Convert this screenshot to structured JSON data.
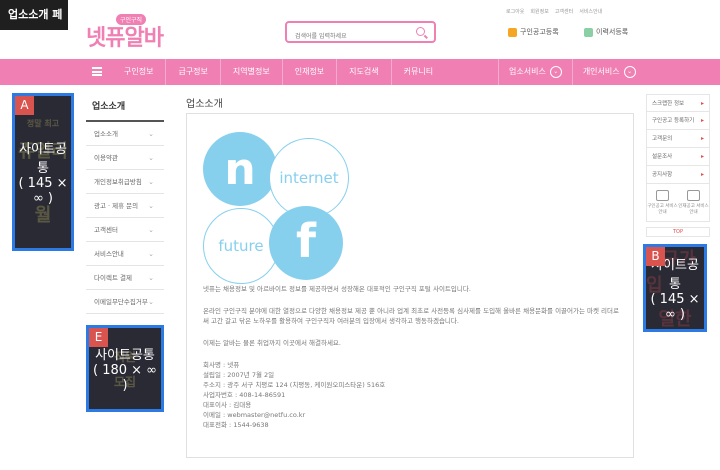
{
  "page_label": "업소소개 페이지",
  "header": {
    "logo_text": "넷퓨알바",
    "logo_badge": "구인구직",
    "search_placeholder": "검색어를 입력하세요",
    "top_links": [
      "로그아웃",
      "회원정보",
      "고객센터",
      "서비스안내"
    ],
    "post_job_label": "구인공고등록",
    "resume_label": "이력서등록"
  },
  "nav": {
    "items": [
      "구인정보",
      "급구정보",
      "지역별정보",
      "인재정보",
      "지도검색",
      "커뮤니티"
    ],
    "business_service": "업소서비스",
    "personal_service": "개인서비스"
  },
  "ads": {
    "a": {
      "letter": "A",
      "line1": "사이트공통",
      "line2": "( 145 × ∞ )",
      "bg_words": [
        "정말 최고",
        "쥬얼리",
        "월"
      ]
    },
    "b": {
      "letter": "B",
      "line1": "사이트공통",
      "line2": "( 145 × ∞ )",
      "bg_words": [
        "신규가입",
        "열한"
      ]
    },
    "e": {
      "letter": "E",
      "line1": "사이트공통",
      "line2": "( 180 × ∞ )",
      "bg_words": [
        "직원",
        "모집"
      ]
    }
  },
  "sidebar": {
    "title": "업소소개",
    "items": [
      "업소소개",
      "이용약관",
      "개인정보취급방침",
      "광고 · 제휴 문의",
      "고객센터",
      "서비스안내",
      "다이렉트 결제",
      "이메일무단수집거부"
    ]
  },
  "content": {
    "title": "업소소개",
    "logo_words": {
      "n": "n",
      "internet": "internet",
      "future": "future",
      "f": "f"
    },
    "paragraph1": "넷퓨는 채용정보 및 아르바이트 정보를 제공하면서 성장해온 대표적인 구인구직 포털 사이트입니다.",
    "paragraph2": "온라인 구인구직 분야에 대한 열정으로 다양한 채용정보 제공 뿐 아니라 업계 최초로 사전등록 심사제를 도입해 올바른 채용문화를 이끌어가는 마켓 리더로써 고간 갈고 닦은 노하우를 활용하여 구인구직자 여러분의 입장에서 생각하고 행동하겠습니다.",
    "paragraph3": "이제는 알바는 물론 취업까지 이곳에서 해결하세요.",
    "company": [
      "회사명 : 넷퓨",
      "설립일 : 2007년 7월 2일",
      "주소지 : 광주 서구 치평로 124 (치평동, 케이원오피스타운) 516호",
      "사업자번호 : 408-14-86591",
      "대표이사 : 김대용",
      "이메일 : webmaster@netfu.co.kr",
      "대표전화 : 1544-9638"
    ]
  },
  "right_sidebar": {
    "items": [
      "스크랩한 정보",
      "구인공고 등록하기",
      "고객문의",
      "설문조사",
      "공지사항"
    ],
    "icons": [
      "구인공고 서비스안내",
      "인재공고 서비스안내"
    ],
    "top_label": "TOP"
  }
}
